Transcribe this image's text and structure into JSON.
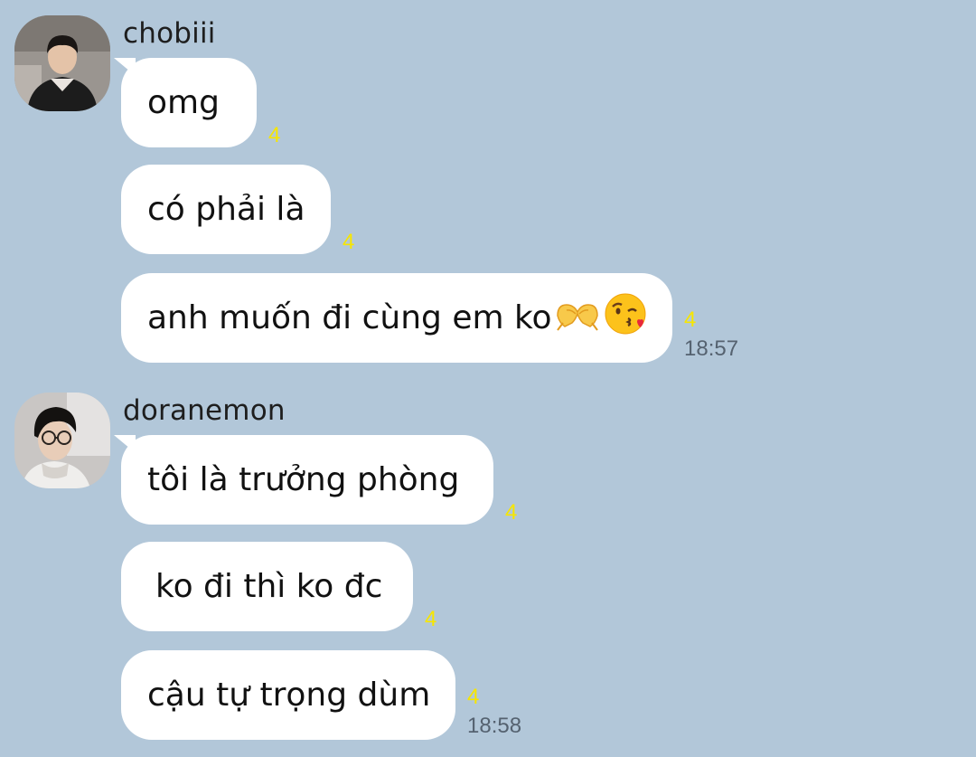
{
  "groups": [
    {
      "sender": "chobiii",
      "messages": [
        {
          "text": "omg",
          "unread": "4"
        },
        {
          "text": "có phải là",
          "unread": "4"
        },
        {
          "text": "anh muốn đi cùng em ko",
          "unread": "4",
          "emojis": [
            "heart-hands-icon",
            "kissing-face-heart-icon"
          ],
          "time": "18:57"
        }
      ]
    },
    {
      "sender": "doranemon",
      "messages": [
        {
          "text": "tôi là trưởng phòng",
          "unread": "4"
        },
        {
          "text": "ko đi thì ko đc",
          "unread": "4"
        },
        {
          "text": "cậu tự trọng dùm",
          "unread": "4",
          "time": "18:58"
        }
      ]
    }
  ],
  "colors": {
    "background": "#b2c7d9",
    "bubble": "#ffffff",
    "unread": "#f7e600",
    "time": "#556270"
  }
}
